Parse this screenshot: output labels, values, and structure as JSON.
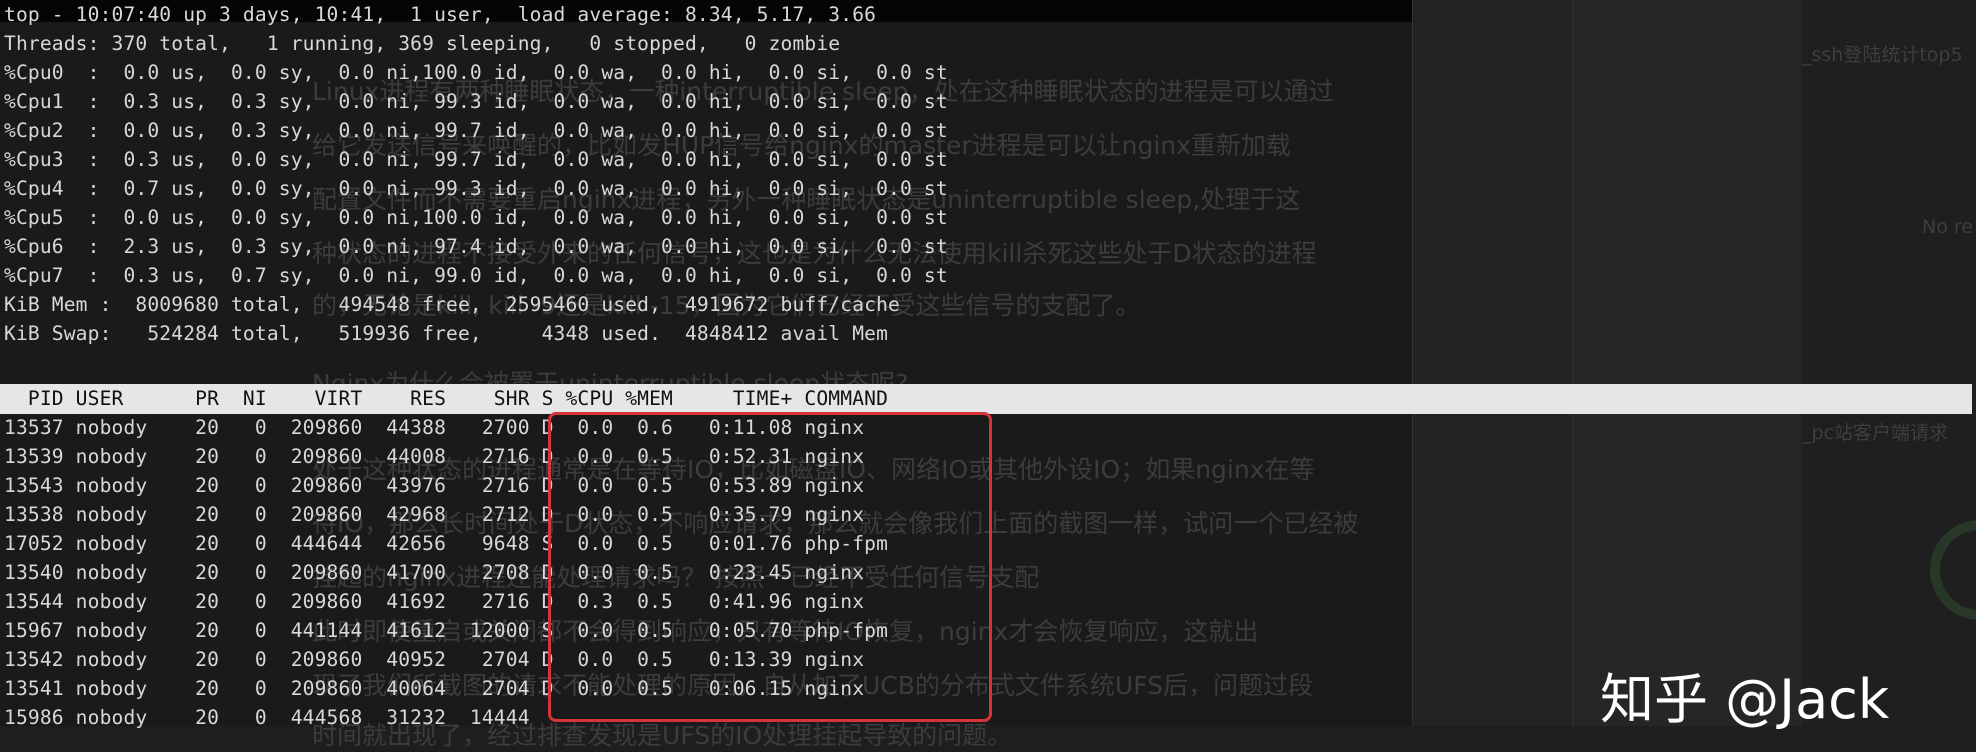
{
  "summary": [
    "top - 10:07:40 up 3 days, 10:41,  1 user,  load average: 8.34, 5.17, 3.66",
    "Threads: 370 total,   1 running, 369 sleeping,   0 stopped,   0 zombie",
    "%Cpu0  :  0.0 us,  0.0 sy,  0.0 ni,100.0 id,  0.0 wa,  0.0 hi,  0.0 si,  0.0 st",
    "%Cpu1  :  0.3 us,  0.3 sy,  0.0 ni, 99.3 id,  0.0 wa,  0.0 hi,  0.0 si,  0.0 st",
    "%Cpu2  :  0.0 us,  0.3 sy,  0.0 ni, 99.7 id,  0.0 wa,  0.0 hi,  0.0 si,  0.0 st",
    "%Cpu3  :  0.3 us,  0.0 sy,  0.0 ni, 99.7 id,  0.0 wa,  0.0 hi,  0.0 si,  0.0 st",
    "%Cpu4  :  0.7 us,  0.0 sy,  0.0 ni, 99.3 id,  0.0 wa,  0.0 hi,  0.0 si,  0.0 st",
    "%Cpu5  :  0.0 us,  0.0 sy,  0.0 ni,100.0 id,  0.0 wa,  0.0 hi,  0.0 si,  0.0 st",
    "%Cpu6  :  2.3 us,  0.3 sy,  0.0 ni, 97.4 id,  0.0 wa,  0.0 hi,  0.0 si,  0.0 st",
    "%Cpu7  :  0.3 us,  0.7 sy,  0.0 ni, 99.0 id,  0.0 wa,  0.0 hi,  0.0 si,  0.0 st",
    "KiB Mem :  8009680 total,   494548 free,  2595460 used,  4919672 buff/cache",
    "KiB Swap:   524284 total,   519936 free,     4348 used.  4848412 avail Mem"
  ],
  "table_header": "  PID USER      PR  NI    VIRT    RES    SHR S %CPU %MEM     TIME+ COMMAND",
  "processes": [
    "13537 nobody    20   0  209860  44388   2700 D  0.0  0.6   0:11.08 nginx",
    "13539 nobody    20   0  209860  44008   2716 D  0.0  0.5   0:52.31 nginx",
    "13543 nobody    20   0  209860  43976   2716 D  0.0  0.5   0:53.89 nginx",
    "13538 nobody    20   0  209860  42968   2712 D  0.0  0.5   0:35.79 nginx",
    "17052 nobody    20   0  444644  42656   9648 S  0.0  0.5   0:01.76 php-fpm",
    "13540 nobody    20   0  209860  41700   2708 D  0.0  0.5   0:23.45 nginx",
    "13544 nobody    20   0  209860  41692   2716 D  0.3  0.5   0:41.96 nginx",
    "15967 nobody    20   0  441144  41612  12000 S  0.0  0.5   0:05.70 php-fpm",
    "13542 nobody    20   0  209860  40952   2704 D  0.0  0.5   0:13.39 nginx",
    "13541 nobody    20   0  209860  40064   2704 D  0.0  0.5   0:06.15 nginx",
    "15986 nobody    20   0  444568  31232  14444"
  ],
  "background_text": [
    "Linux进程有两种睡眠状态，一种interruptible sleep，处在这种睡眠状态的进程是可以通过",
    "给它发送信号来唤醒的，比如发HUP信号给nginx的master进程是可以让nginx重新加载",
    "配置文件而不需要重启nginx进程；另外一种睡眠状态是uninterruptible sleep,处理于这",
    "种状态的进程不接受外来的任何信号，这也是为什么无法使用kill杀死这些处于D状态的进程",
    "的，无论是kill, kill -9还是kill -15，因为它们已经不受这些信号的支配了。",
    "Nginx为什么会被置于uninterruptible sleep状态呢?",
    "处于这种状态的进程通常是在等待IO，比如磁盘IO、网络IO或其他外设IO；如果nginx在等",
    "待IO，那么长时间处于D状态，不响应请求，那么就会像我们上面的截图一样，试问一个已经被",
    "挂起的nginx进程还能处理请求吗？ 按照一已经不受任何信号支配",
    "此时即使重启或关闭都不会得到响应，只有等待IO恢复，nginx才会恢复响应，这就出",
    "现了我们所截图的请求不能处理的原因，自从加了UCB的分布式文件系统UFS后，问题过段",
    "时间就出现了，经过排查发现是UFS的IO处理挂起导致的问题。"
  ],
  "sidebar_snippets": [
    "_ssh登陆统计top5",
    "No re",
    "_pc站客户端请求",
    "_pc站客户端请求数"
  ],
  "watermark": "知乎 @Jack"
}
